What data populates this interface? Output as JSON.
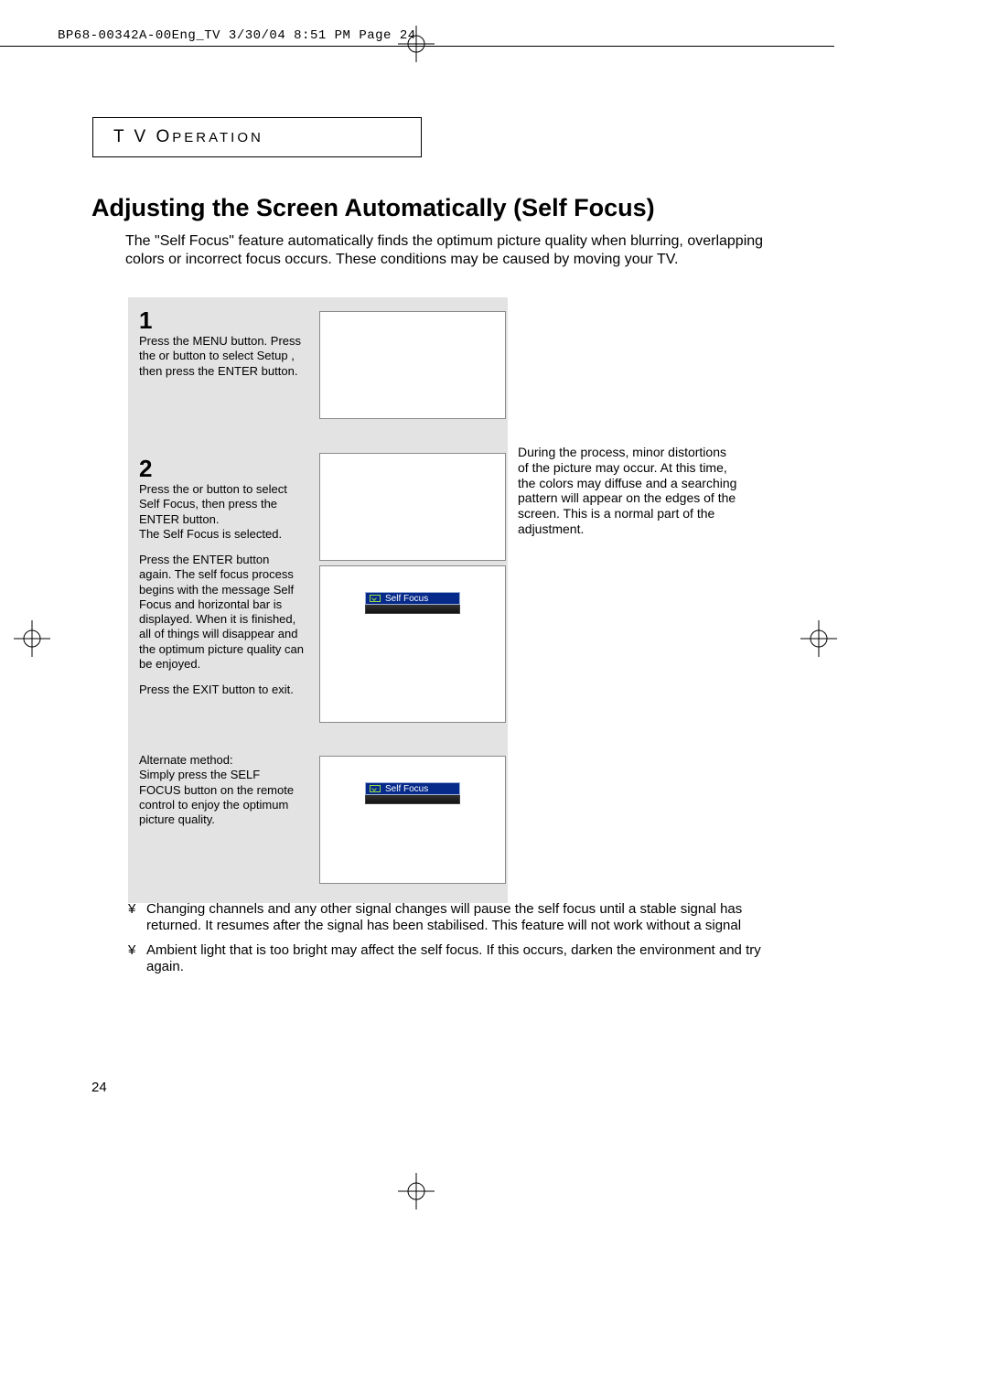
{
  "header": "BP68-00342A-00Eng_TV  3/30/04  8:51 PM  Page 24",
  "section_label_a": "T V  O",
  "section_label_b": "PERATION",
  "title": "Adjusting the Screen Automatically (Self Focus)",
  "intro": "The \"Self Focus\" feature automatically finds the optimum picture quality when blurring, overlapping colors or incorrect focus occurs. These conditions may be caused by moving your TV.",
  "steps": {
    "s1_num": "1",
    "s1_text": "Press the MENU button. Press the   or    button to select  Setup , then press the ENTER button.",
    "s2_num": "2",
    "s2_text_a": "Press the   or    button to select  Self Focus, then press the ENTER button.\nThe  Self Focus is selected.",
    "s2_text_b": "Press the ENTER button again. The self focus process begins with the message Self Focus and horizontal bar is displayed. When it is finished, all of things will disappear and the optimum picture quality can be enjoyed.",
    "s2_text_c": "Press the EXIT button to exit.",
    "s3_text": "Alternate method:\nSimply press the SELF FOCUS button on the remote control to enjoy the optimum picture quality."
  },
  "osd_label": "Self Focus",
  "side_note": "During the process, minor distortions of the picture may occur. At this time, the colors may diffuse and a searching pattern will appear on the edges of the screen. This is a normal part of the adjustment.",
  "bullets": {
    "mark": "¥",
    "b1": "Changing channels and any other signal changes will pause the self focus until a stable signal has returned. It resumes after the signal has been stabilised. This feature will not work without a signal",
    "b2": "Ambient light that is too bright may affect the self focus. If this occurs, darken the environment and try again."
  },
  "page_number": "24"
}
